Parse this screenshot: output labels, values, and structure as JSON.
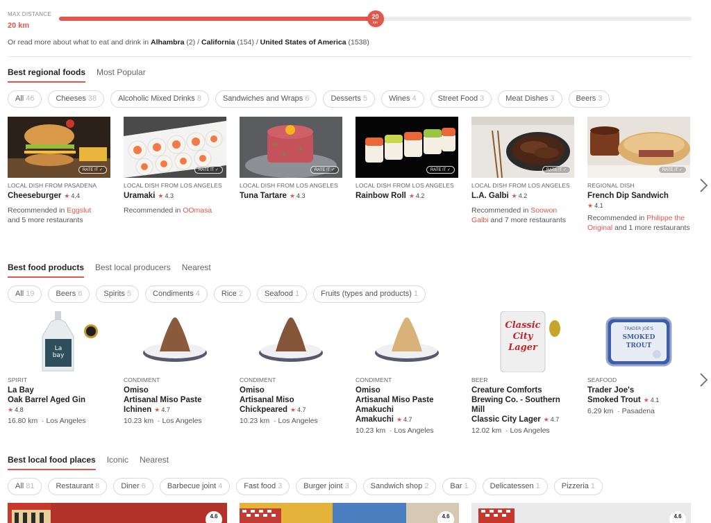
{
  "distance": {
    "label": "MAX DISTANCE",
    "value": "20 km",
    "thumb_number": "20",
    "thumb_unit": "km",
    "level_fraction": 0.5
  },
  "read_more": {
    "prefix": "Or read more about what to eat and drink in",
    "place1": "Alhambra",
    "count1": "(2)",
    "sep1": "/",
    "place2": "California",
    "count2": "(154)",
    "sep2": "/",
    "place3": "United States of America",
    "count3": "(1538)"
  },
  "regional": {
    "tabs": [
      "Best regional foods",
      "Most Popular"
    ],
    "filters": [
      {
        "label": "All",
        "count": "46"
      },
      {
        "label": "Cheeses",
        "count": "38"
      },
      {
        "label": "Alcoholic Mixed Drinks",
        "count": "8"
      },
      {
        "label": "Sandwiches and Wraps",
        "count": "6"
      },
      {
        "label": "Desserts",
        "count": "5"
      },
      {
        "label": "Wines",
        "count": "4"
      },
      {
        "label": "Street Food",
        "count": "3"
      },
      {
        "label": "Meat Dishes",
        "count": "3"
      },
      {
        "label": "Beers",
        "count": "3"
      }
    ],
    "rate_label": "RATE IT",
    "cards": [
      {
        "meta": "LOCAL DISH FROM PASADENA",
        "name": "Cheeseburger",
        "rating": "4.4",
        "rec_prefix": "Recommended in",
        "rec_link": "Eggslut",
        "rec_suffix": "and 5 more restaurants"
      },
      {
        "meta": "LOCAL DISH FROM LOS ANGELES",
        "name": "Uramaki",
        "rating": "4.3",
        "rec_prefix": "Recommended in",
        "rec_link": "OOmasa",
        "rec_suffix": ""
      },
      {
        "meta": "LOCAL DISH FROM LOS ANGELES",
        "name": "Tuna Tartare",
        "rating": "4.3",
        "rec_prefix": "",
        "rec_link": "",
        "rec_suffix": ""
      },
      {
        "meta": "LOCAL DISH FROM LOS ANGELES",
        "name": "Rainbow Roll",
        "rating": "4.2",
        "rec_prefix": "",
        "rec_link": "",
        "rec_suffix": ""
      },
      {
        "meta": "LOCAL DISH FROM LOS ANGELES",
        "name": "L.A. Galbi",
        "rating": "4.2",
        "rec_prefix": "Recommended in",
        "rec_link": "Soowon Galbi",
        "rec_suffix": "and 7 more restaurants"
      },
      {
        "meta": "REGIONAL DISH",
        "name": "French Dip Sandwich",
        "rating": "4.1",
        "rec_prefix": "Recommended in",
        "rec_link": "Philippe the Original",
        "rec_suffix": "and 1 more restaurants"
      }
    ]
  },
  "products": {
    "tabs": [
      "Best food products",
      "Best local producers",
      "Nearest"
    ],
    "filters": [
      {
        "label": "All",
        "count": "19"
      },
      {
        "label": "Beers",
        "count": "6"
      },
      {
        "label": "Spirits",
        "count": "5"
      },
      {
        "label": "Condiments",
        "count": "4"
      },
      {
        "label": "Rice",
        "count": "2"
      },
      {
        "label": "Seafood",
        "count": "1"
      },
      {
        "label": "Fruits (types and products)",
        "count": "1"
      }
    ],
    "cards": [
      {
        "meta": "SPIRIT",
        "brand": "La Bay",
        "name": "Oak Barrel Aged Gin",
        "rating": "4.8",
        "distance": "16.80 km",
        "sep": "·",
        "city": "Los Angeles"
      },
      {
        "meta": "CONDIMENT",
        "brand": "Omiso",
        "name": "Artisanal Miso Paste Ichinen",
        "rating": "4.7",
        "distance": "10.23 km",
        "sep": "·",
        "city": "Los Angeles"
      },
      {
        "meta": "CONDIMENT",
        "brand": "Omiso",
        "name": "Artisanal Miso Chickpeared",
        "rating": "4.7",
        "distance": "10.23 km",
        "sep": "·",
        "city": "Los Angeles"
      },
      {
        "meta": "CONDIMENT",
        "brand": "Omiso",
        "name": "Artisanal Miso Paste Amakuchi",
        "rating": "4.7",
        "distance": "10.23 km",
        "sep": "·",
        "city": "Los Angeles"
      },
      {
        "meta": "BEER",
        "brand": "Creature Comforts Brewing Co. - Southern Mill",
        "name": "Classic City Lager",
        "rating": "4.7",
        "distance": "12.02 km",
        "sep": "·",
        "city": "Los Angeles"
      },
      {
        "meta": "SEAFOOD",
        "brand": "Trader Joe's",
        "name": "Smoked Trout",
        "rating": "4.1",
        "distance": "6.29 km",
        "sep": "·",
        "city": "Pasadena"
      }
    ],
    "label_text": {
      "bottle_line1": "La",
      "bottle_line2": "bay",
      "can_line1": "Classic",
      "can_line2": "City",
      "can_line3": "Lager",
      "tin_brand": "TRADER JOE'S",
      "tin_line1": "SMOKED",
      "tin_line2": "TROUT"
    }
  },
  "places": {
    "tabs": [
      "Best local food places",
      "Iconic",
      "Nearest"
    ],
    "filters": [
      {
        "label": "All",
        "count": "81"
      },
      {
        "label": "Restaurant",
        "count": "8"
      },
      {
        "label": "Diner",
        "count": "6"
      },
      {
        "label": "Barbecue joint",
        "count": "4"
      },
      {
        "label": "Fast food",
        "count": "3"
      },
      {
        "label": "Burger joint",
        "count": "3"
      },
      {
        "label": "Sandwich shop",
        "count": "2"
      },
      {
        "label": "Bar",
        "count": "1"
      },
      {
        "label": "Delicatessen",
        "count": "1"
      },
      {
        "label": "Pizzeria",
        "count": "1"
      }
    ],
    "ratings": [
      "4.6",
      "4.6",
      "4.6"
    ]
  },
  "colors": {
    "accent": "#e2574c"
  },
  "icons": {
    "next": "chevron-right-icon",
    "rate": "check-icon",
    "star": "star-icon"
  }
}
